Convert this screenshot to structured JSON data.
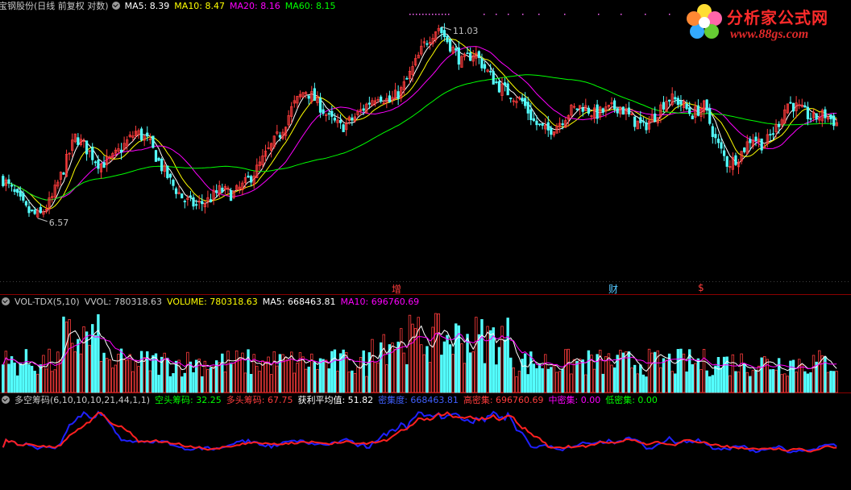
{
  "main": {
    "legend": {
      "title": "宝钢股份(日线 前复权 对数)",
      "ma5": "MA5: 8.39",
      "ma10": "MA10: 8.47",
      "ma20": "MA20: 8.16",
      "ma60": "MA60: 8.15"
    },
    "high_label": "11.03",
    "low_label": "6.57",
    "markers": {
      "zeng": "增",
      "cai": "财",
      "dollar": "$"
    }
  },
  "vol": {
    "legend": {
      "name": "VOL-TDX(5,10)",
      "vvol": "VVOL: 780318.63",
      "volume": "VOLUME: 780318.63",
      "ma5": "MA5: 668463.81",
      "ma10": "MA10: 696760.69"
    }
  },
  "chip": {
    "legend": {
      "name": "多空筹码(6,10,10,10,21,44,1,1)",
      "short": "空头筹码: 32.25",
      "long": "多头筹码: 67.75",
      "avg": "获利平均值: 51.82",
      "dense": "密集度: 668463.81",
      "high": "高密集: 696760.69",
      "mid": "中密集: 0.00",
      "low": "低密集: 0.00"
    }
  },
  "logo": {
    "text": "分析家公式网",
    "url": "www.88gs.com"
  },
  "colors": {
    "up": "#ff3c3c",
    "down": "#54ffff",
    "ma5": "#ffffff",
    "ma10": "#ffff00",
    "ma20": "#ff00ff",
    "ma60": "#00ff00",
    "chip_short": "#2020ff",
    "chip_long": "#ff2020",
    "grid": "#8b0000"
  },
  "chart_data": [
    {
      "type": "candlestick",
      "title": "宝钢股份(日线 前复权 对数)",
      "series": [
        {
          "name": "MA5",
          "last": 8.39
        },
        {
          "name": "MA10",
          "last": 8.47
        },
        {
          "name": "MA20",
          "last": 8.16
        },
        {
          "name": "MA60",
          "last": 8.15
        }
      ],
      "annotations": [
        {
          "label": "11.03",
          "type": "max"
        },
        {
          "label": "6.57",
          "type": "min"
        }
      ],
      "price_trajectory": [
        7.3,
        7.0,
        6.7,
        6.6,
        6.9,
        7.5,
        8.2,
        7.9,
        7.6,
        7.7,
        8.0,
        8.3,
        8.1,
        7.6,
        7.2,
        6.9,
        6.8,
        6.9,
        7.1,
        7.0,
        7.2,
        7.5,
        7.9,
        8.3,
        8.9,
        9.3,
        9.0,
        8.6,
        8.4,
        8.6,
        8.9,
        9.2,
        9.0,
        9.3,
        9.9,
        10.6,
        11.03,
        10.5,
        10.0,
        10.3,
        9.8,
        9.4,
        9.2,
        9.0,
        8.5,
        8.3,
        8.5,
        8.8,
        8.9,
        8.7,
        8.8,
        8.9,
        8.6,
        8.4,
        8.7,
        9.1,
        9.0,
        8.7,
        8.9,
        8.1,
        7.6,
        7.8,
        8.2,
        8.0,
        8.4,
        9.0,
        8.8,
        8.6,
        8.7,
        8.5
      ]
    },
    {
      "type": "bar",
      "title": "VOL-TDX(5,10)",
      "series": [
        {
          "name": "VVOL",
          "last": 780318.63
        },
        {
          "name": "VOLUME",
          "last": 780318.63
        },
        {
          "name": "MA5",
          "last": 668463.81
        },
        {
          "name": "MA10",
          "last": 696760.69
        }
      ]
    },
    {
      "type": "line",
      "title": "多空筹码(6,10,10,10,21,44,1,1)",
      "series": [
        {
          "name": "空头筹码",
          "last": 32.25
        },
        {
          "name": "多头筹码",
          "last": 67.75
        }
      ],
      "extra": {
        "获利平均值": 51.82,
        "密集度": 668463.81,
        "高密集": 696760.69,
        "中密集": 0.0,
        "低密集": 0.0
      }
    }
  ]
}
